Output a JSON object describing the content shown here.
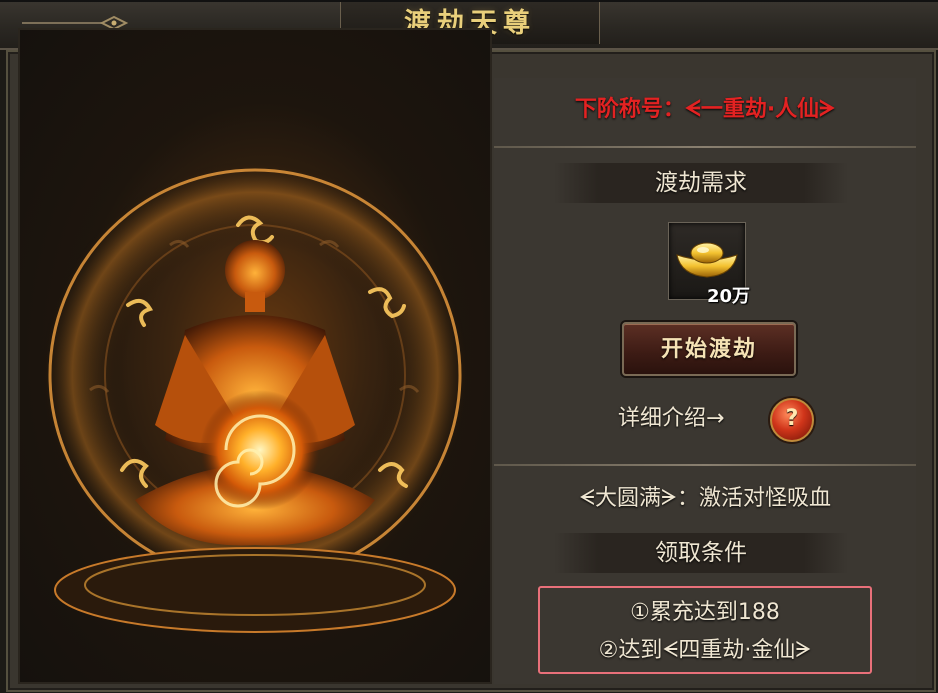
{
  "window": {
    "title": "渡劫天尊"
  },
  "next_rank": {
    "text": "下阶称号：ᗕ一重劫·人仙ᗒ"
  },
  "requirement": {
    "header": "渡劫需求",
    "item_icon": "gold-ingot-icon",
    "item_count": "20万"
  },
  "actions": {
    "start_label": "开始渡劫",
    "detail_label": "详细介绍→",
    "help_symbol": "?"
  },
  "reward": {
    "text": "ᗕ大圆满ᗒ：激活对怪吸血"
  },
  "conditions": {
    "header": "领取条件",
    "items": [
      "①累充达到188",
      "②达到ᗕ四重劫·金仙ᗒ"
    ]
  },
  "colors": {
    "title_gold": "#e9cf7b",
    "next_rank_red": "#e32222",
    "highlight_box": "#e9707a",
    "panel_bg": "#3b3731"
  }
}
